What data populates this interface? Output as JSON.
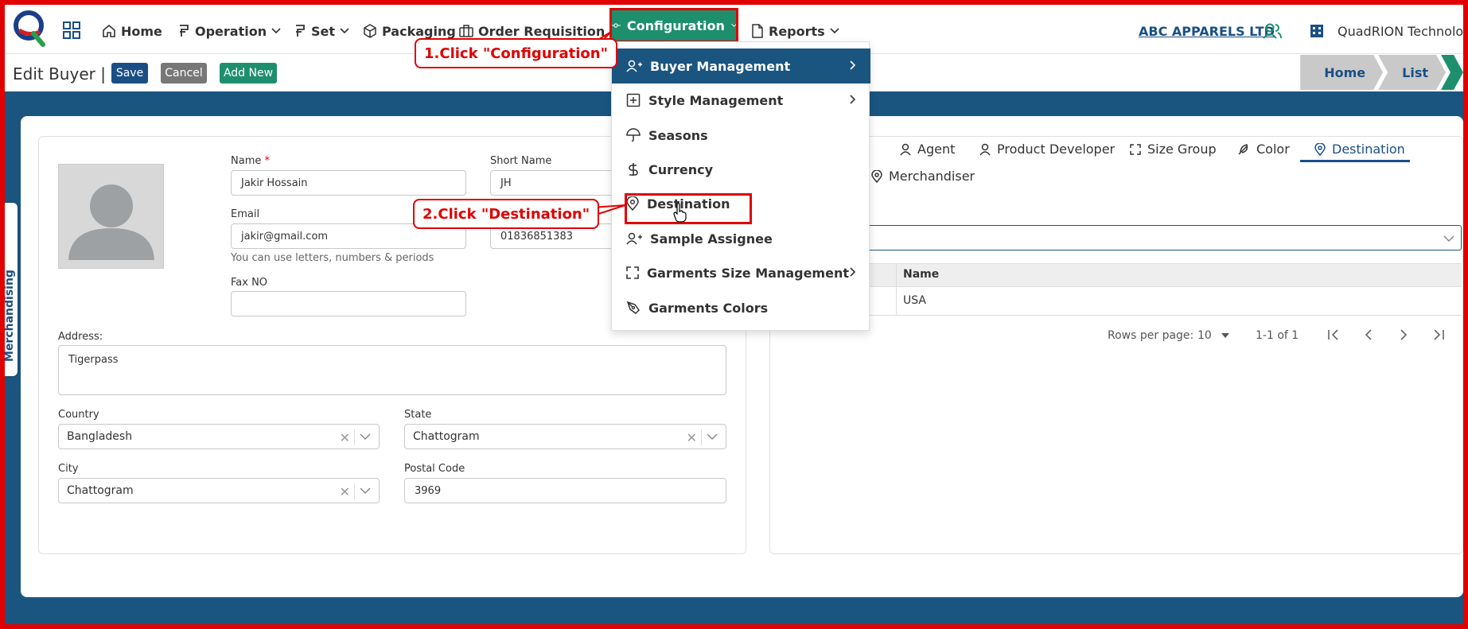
{
  "nav": {
    "home": "Home",
    "operation": "Operation",
    "set": "Set",
    "packaging": "Packaging",
    "order_requisition": "Order Requisition",
    "configuration": "Configuration",
    "reports": "Reports",
    "company": "ABC APPARELS LTD",
    "org": "QuadRION Technologies"
  },
  "toolbar": {
    "title": "Edit Buyer |",
    "save": "Save",
    "cancel": "Cancel",
    "add_new": "Add New",
    "breadcrumb": [
      "Home",
      "List"
    ]
  },
  "side_tab": "Merchandising",
  "form": {
    "name_label": "Name",
    "name_required": "*",
    "name_value": "Jakir Hossain",
    "short_name_label": "Short Name",
    "short_name_value": "JH",
    "email_label": "Email",
    "email_value": "jakir@gmail.com",
    "email_help": "You can use letters, numbers & periods",
    "phone_value": "01836851383",
    "fax_label": "Fax NO",
    "fax_value": "",
    "address_label": "Address:",
    "address_value": "Tigerpass",
    "country_label": "Country",
    "country_value": "Bangladesh",
    "state_label": "State",
    "state_value": "Chattogram",
    "city_label": "City",
    "city_value": "Chattogram",
    "postal_label": "Postal Code",
    "postal_value": "3969"
  },
  "right_panel": {
    "tabs": [
      "Agent",
      "Product Developer",
      "Size Group",
      "Color",
      "Destination",
      "Merchandiser"
    ],
    "active_tab": "Destination",
    "table_header": "Name",
    "table_rows": [
      "USA"
    ],
    "rows_per_page_label": "Rows per page:",
    "rows_per_page": "10",
    "range": "1-1 of 1"
  },
  "dropdown": {
    "items": [
      "Buyer Management",
      "Style Management",
      "Seasons",
      "Currency",
      "Destination",
      "Sample Assignee",
      "Garments Size Management",
      "Garments Colors"
    ],
    "active": "Buyer Management"
  },
  "annotations": {
    "step1": "1.Click \"Configuration\"",
    "step2": "2.Click \"Destination\""
  },
  "colors": {
    "primary": "#1a5580",
    "accent_green": "#1e8f6d",
    "annotation_red": "#e00000"
  }
}
